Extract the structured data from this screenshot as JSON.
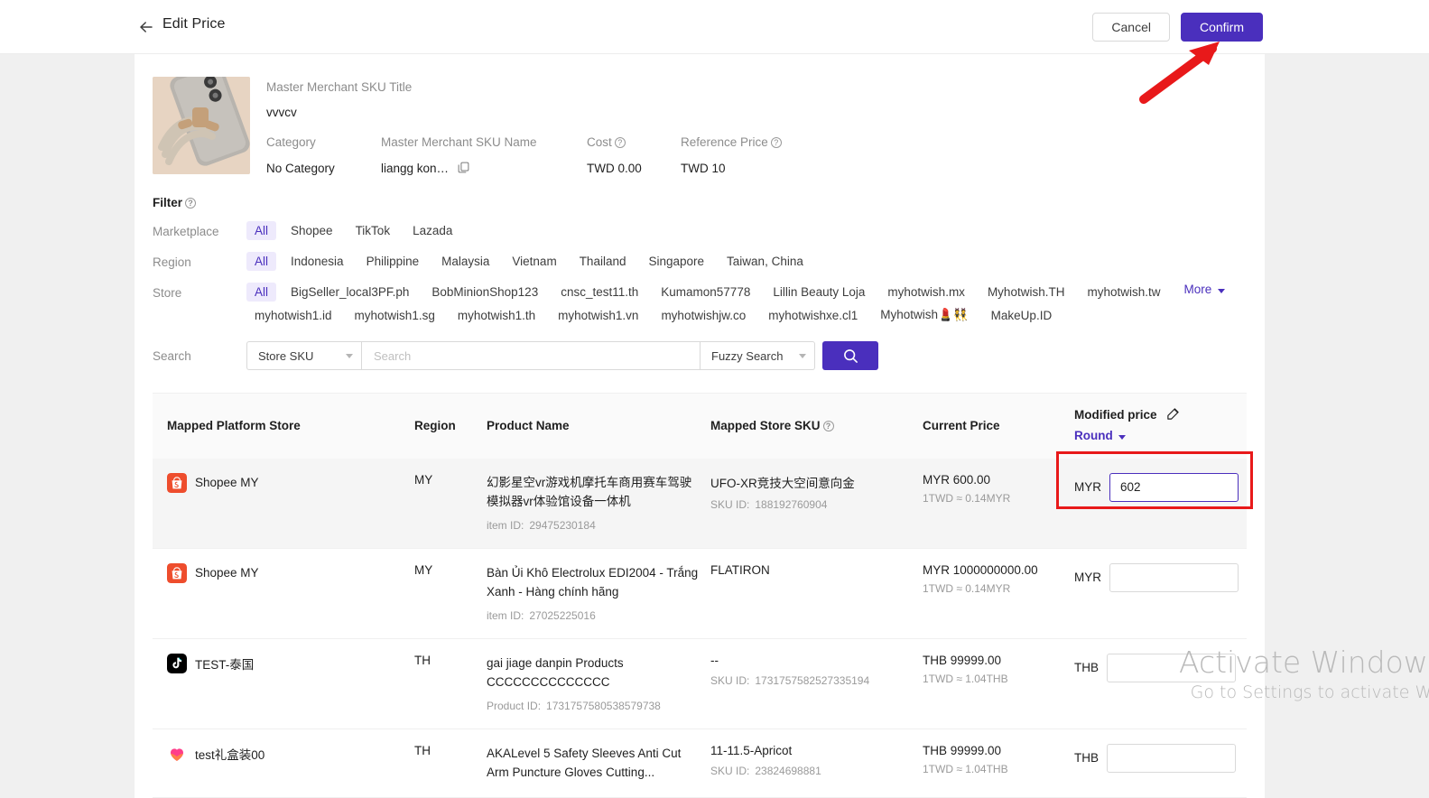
{
  "header": {
    "back_icon": "arrow-left-icon",
    "title": "Edit Price",
    "cancel_label": "Cancel",
    "confirm_label": "Confirm",
    "confirm_color": "#4a2fbd"
  },
  "product": {
    "sku_title_label": "Master Merchant SKU Title",
    "sku_title_value": "vvvcv",
    "category_label": "Category",
    "category_value": "No Category",
    "sku_name_label": "Master Merchant SKU Name",
    "sku_name_value": "liangg kon…",
    "cost_label": "Cost",
    "cost_value": "TWD 0.00",
    "reference_price_label": "Reference Price",
    "reference_price_value": "TWD 10"
  },
  "filter": {
    "title": "Filter",
    "marketplace_label": "Marketplace",
    "marketplace_options": [
      "All",
      "Shopee",
      "TikTok",
      "Lazada"
    ],
    "marketplace_selected": "All",
    "region_label": "Region",
    "region_options": [
      "All",
      "Indonesia",
      "Philippine",
      "Malaysia",
      "Vietnam",
      "Thailand",
      "Singapore",
      "Taiwan, China"
    ],
    "region_selected": "All",
    "store_label": "Store",
    "store_options": [
      "All",
      "BigSeller_local3PF.ph",
      "BobMinionShop123",
      "cnsc_test11.th",
      "Kumamon57778",
      "Lillin Beauty Loja",
      "myhotwish.mx",
      "Myhotwish.TH",
      "myhotwish.tw",
      "myhotwish1.id",
      "myhotwish1.sg",
      "myhotwish1.th",
      "myhotwish1.vn",
      "myhotwishjw.co",
      "myhotwishxe.cl1",
      "Myhotwish💄👯",
      "MakeUp.ID"
    ],
    "store_selected": "All",
    "more_label": "More"
  },
  "search": {
    "label": "Search",
    "field_selector_value": "Store SKU",
    "input_value": "",
    "input_placeholder": "Search",
    "mode_selector_value": "Fuzzy Search",
    "search_icon": "search-icon"
  },
  "table": {
    "columns": [
      "Mapped Platform Store",
      "Region",
      "Product Name",
      "Mapped Store SKU",
      "Current Price",
      "Modified price"
    ],
    "modified_price_round_label": "Round",
    "item_id_label": "item ID:",
    "sku_id_label": "SKU ID:",
    "product_id_label": "Product ID:",
    "rows": [
      {
        "store_icon": "shopee-icon",
        "store_name": "Shopee MY",
        "region": "MY",
        "product_name": "幻影星空vr游戏机摩托车商用赛车驾驶模拟器vr体验馆设备一体机",
        "id_label": "item ID:",
        "id_value": "29475230184",
        "mapped_sku": "UFO-XR竞技大空间意向金",
        "mapped_sku_id_label": "SKU ID:",
        "mapped_sku_id": "188192760904",
        "current_price": "MYR 600.00",
        "rate_note": "1TWD ≈ 0.14MYR",
        "modified_currency": "MYR",
        "modified_value": "602",
        "selected": true
      },
      {
        "store_icon": "shopee-icon",
        "store_name": "Shopee MY",
        "region": "MY",
        "product_name": "Bàn Ủi Khô Electrolux EDI2004 - Trắng Xanh - Hàng chính hãng",
        "id_label": "item ID:",
        "id_value": "27025225016",
        "mapped_sku": "FLATIRON",
        "mapped_sku_id_label": "",
        "mapped_sku_id": "",
        "current_price": "MYR 1000000000.00",
        "rate_note": "1TWD ≈ 0.14MYR",
        "modified_currency": "MYR",
        "modified_value": "",
        "selected": false
      },
      {
        "store_icon": "tiktok-icon",
        "store_name": "TEST-泰国",
        "region": "TH",
        "product_name": "gai jiage danpin Products CCCCCCCCCCCCCC",
        "id_label": "Product ID:",
        "id_value": "1731757580538579738",
        "mapped_sku": "--",
        "mapped_sku_id_label": "SKU ID:",
        "mapped_sku_id": "1731757582527335194",
        "current_price": "THB 99999.00",
        "rate_note": "1TWD ≈ 1.04THB",
        "modified_currency": "THB",
        "modified_value": "",
        "selected": false
      },
      {
        "store_icon": "heart-icon",
        "store_name": "test礼盒装00",
        "region": "TH",
        "product_name": "AKALevel 5 Safety Sleeves Anti Cut Arm Puncture Gloves Cutting...",
        "id_label": "",
        "id_value": "",
        "mapped_sku": "11-11.5-Apricot",
        "mapped_sku_id_label": "SKU ID:",
        "mapped_sku_id": "23824698881",
        "current_price": "THB 99999.00",
        "rate_note": "1TWD ≈ 1.04THB",
        "modified_currency": "THB",
        "modified_value": "",
        "selected": false
      }
    ]
  },
  "watermark": {
    "line1": "Activate Windows",
    "line2": "Go to Settings to activate W"
  },
  "annotations": {
    "arrow_color": "#e8191a",
    "box_color": "#e8191a"
  }
}
